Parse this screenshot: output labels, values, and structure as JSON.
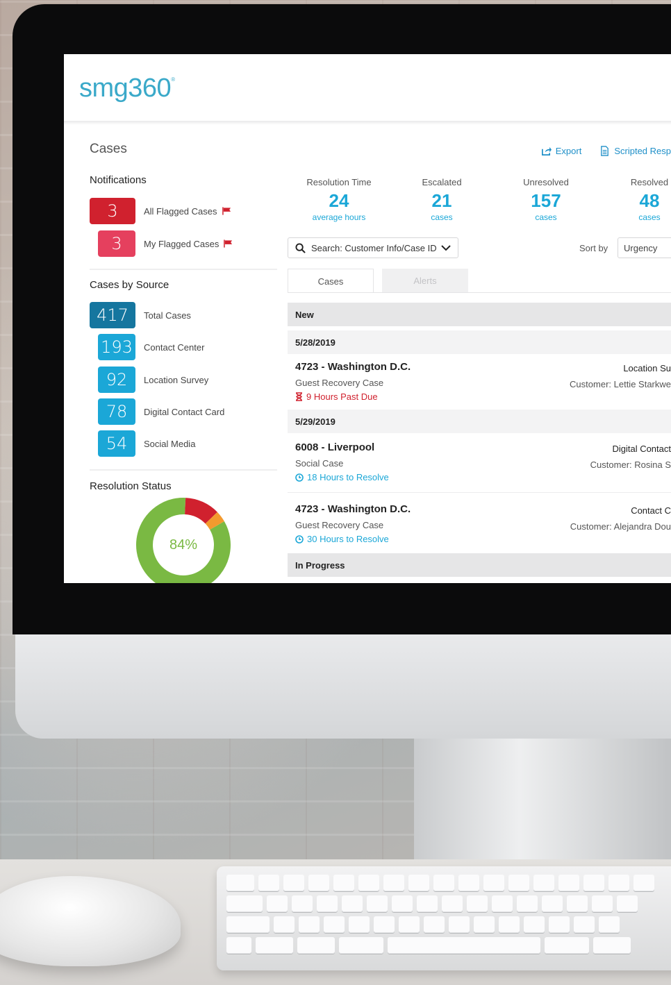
{
  "app": {
    "logo": "smg360",
    "logo_mark": "®"
  },
  "page": {
    "title": "Cases"
  },
  "actions": [
    {
      "label": "Export"
    },
    {
      "label": "Scripted Resp"
    }
  ],
  "notifications": {
    "title": "Notifications",
    "items": [
      {
        "count": "3",
        "label": "All Flagged Cases",
        "color": "#d0212e"
      },
      {
        "count": "3",
        "label": "My Flagged Cases",
        "color": "#e5405e"
      }
    ]
  },
  "sources": {
    "title": "Cases by Source",
    "items": [
      {
        "count": "417",
        "label": "Total Cases",
        "color": "#15769f"
      },
      {
        "count": "193",
        "label": "Contact Center",
        "color": "#1ba7d7"
      },
      {
        "count": "92",
        "label": "Location Survey",
        "color": "#1ba7d7"
      },
      {
        "count": "78",
        "label": "Digital Contact Card",
        "color": "#1ba7d7"
      },
      {
        "count": "54",
        "label": "Social Media",
        "color": "#1ba7d7"
      }
    ]
  },
  "resolution_status": {
    "title": "Resolution Status",
    "center_label": "84%",
    "segments": [
      {
        "value": 84,
        "color": "#7ab943"
      },
      {
        "value": 12,
        "color": "#d0212e"
      },
      {
        "value": 4,
        "color": "#f39a2e"
      }
    ]
  },
  "stats": [
    {
      "label": "Resolution Time",
      "value": "24",
      "sub": "average hours"
    },
    {
      "label": "Escalated",
      "value": "21",
      "sub": "cases"
    },
    {
      "label": "Unresolved",
      "value": "157",
      "sub": "cases"
    },
    {
      "label": "Resolved",
      "value": "48",
      "sub": "cases"
    }
  ],
  "search": {
    "placeholder": "Search: Customer Info/Case ID"
  },
  "sort": {
    "label": "Sort by",
    "value": "Urgency"
  },
  "tabs": [
    {
      "label": "Cases"
    },
    {
      "label": "Alerts"
    }
  ],
  "groups": {
    "new": "New",
    "in_progress": "In Progress",
    "date1": "5/28/2019",
    "date2": "5/29/2019"
  },
  "cases": [
    {
      "title": "4723 - Washington D.C.",
      "type": "Guest Recovery Case",
      "status": "9 Hours Past Due",
      "status_color": "#d0212e",
      "status_icon": "hourglass-icon",
      "source": "Location Su",
      "customer": "Customer: Lettie Starkwe"
    },
    {
      "title": "6008 - Liverpool",
      "type": "Social Case",
      "status": "18 Hours to Resolve",
      "status_color": "#1ba7d7",
      "status_icon": "clock-icon",
      "source": "Digital Contact",
      "customer": "Customer: Rosina S"
    },
    {
      "title": "4723 - Washington D.C.",
      "type": "Guest Recovery Case",
      "status": "30 Hours to Resolve",
      "status_color": "#1ba7d7",
      "status_icon": "clock-icon",
      "source": "Contact C",
      "customer": "Customer: Alejandra Dou"
    }
  ]
}
